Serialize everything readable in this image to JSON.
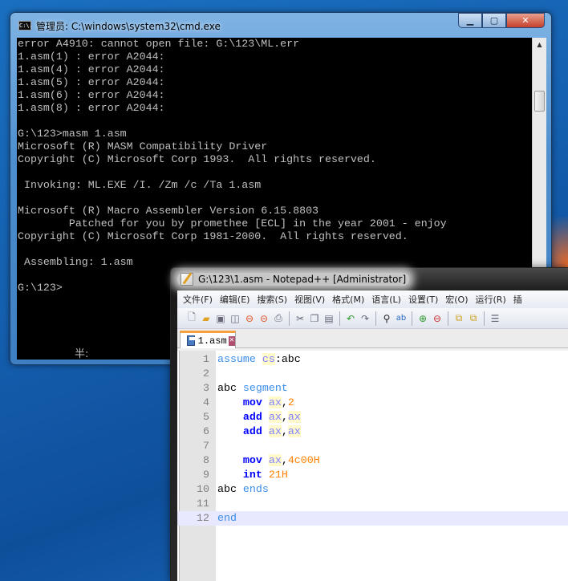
{
  "cmd": {
    "title": "管理员: C:\\windows\\system32\\cmd.exe",
    "icon_text": "C:\\.",
    "buttons": [
      "minimize-icon",
      "maximize-icon",
      "close-icon"
    ],
    "lines": [
      "error A4910: cannot open file: G:\\123\\ML.err",
      "1.asm(1) : error A2044:",
      "1.asm(4) : error A2044:",
      "1.asm(5) : error A2044:",
      "1.asm(6) : error A2044:",
      "1.asm(8) : error A2044:",
      "",
      "G:\\123>masm 1.asm",
      "Microsoft (R) MASM Compatibility Driver",
      "Copyright (C) Microsoft Corp 1993.  All rights reserved.",
      "",
      " Invoking: ML.EXE /I. /Zm /c /Ta 1.asm",
      "",
      "Microsoft (R) Macro Assembler Version 6.15.8803",
      "        Patched for you by promethee [ECL] in the year 2001 - enjoy",
      "Copyright (C) Microsoft Corp 1981-2000.  All rights reserved.",
      "",
      " Assembling: 1.asm",
      "",
      "G:\\123>"
    ],
    "ime_status": "半:"
  },
  "npp": {
    "title": "G:\\123\\1.asm - Notepad++ [Administrator]",
    "menu": [
      "文件(F)",
      "编辑(E)",
      "搜索(S)",
      "视图(V)",
      "格式(M)",
      "语言(L)",
      "设置(T)",
      "宏(O)",
      "运行(R)",
      "插"
    ],
    "tab": "1.asm",
    "current_line": 12,
    "lines": [
      {
        "n": "1",
        "tokens": [
          [
            "kw",
            "assume"
          ],
          [
            "id",
            " "
          ],
          [
            "reg",
            "cs"
          ],
          [
            "id",
            ":abc"
          ]
        ]
      },
      {
        "n": "2",
        "tokens": []
      },
      {
        "n": "3",
        "tokens": [
          [
            "id",
            "abc "
          ],
          [
            "kw",
            "segment"
          ]
        ]
      },
      {
        "n": "4",
        "tokens": [
          [
            "id",
            "    "
          ],
          [
            "ins",
            "mov"
          ],
          [
            "id",
            " "
          ],
          [
            "reg",
            "ax"
          ],
          [
            "id",
            ","
          ],
          [
            "num",
            "2"
          ]
        ]
      },
      {
        "n": "5",
        "tokens": [
          [
            "id",
            "    "
          ],
          [
            "ins",
            "add"
          ],
          [
            "id",
            " "
          ],
          [
            "reg",
            "ax"
          ],
          [
            "id",
            ","
          ],
          [
            "reg",
            "ax"
          ]
        ]
      },
      {
        "n": "6",
        "tokens": [
          [
            "id",
            "    "
          ],
          [
            "ins",
            "add"
          ],
          [
            "id",
            " "
          ],
          [
            "reg",
            "ax"
          ],
          [
            "id",
            ","
          ],
          [
            "reg",
            "ax"
          ]
        ]
      },
      {
        "n": "7",
        "tokens": []
      },
      {
        "n": "8",
        "tokens": [
          [
            "id",
            "    "
          ],
          [
            "ins",
            "mov"
          ],
          [
            "id",
            " "
          ],
          [
            "reg",
            "ax"
          ],
          [
            "id",
            ","
          ],
          [
            "num",
            "4c00H"
          ]
        ]
      },
      {
        "n": "9",
        "tokens": [
          [
            "id",
            "    "
          ],
          [
            "ins",
            "int"
          ],
          [
            "id",
            " "
          ],
          [
            "num",
            "21H"
          ]
        ]
      },
      {
        "n": "10",
        "tokens": [
          [
            "id",
            "abc "
          ],
          [
            "kw",
            "ends"
          ]
        ]
      },
      {
        "n": "11",
        "tokens": []
      },
      {
        "n": "12",
        "tokens": [
          [
            "kw",
            "end"
          ]
        ]
      }
    ]
  }
}
